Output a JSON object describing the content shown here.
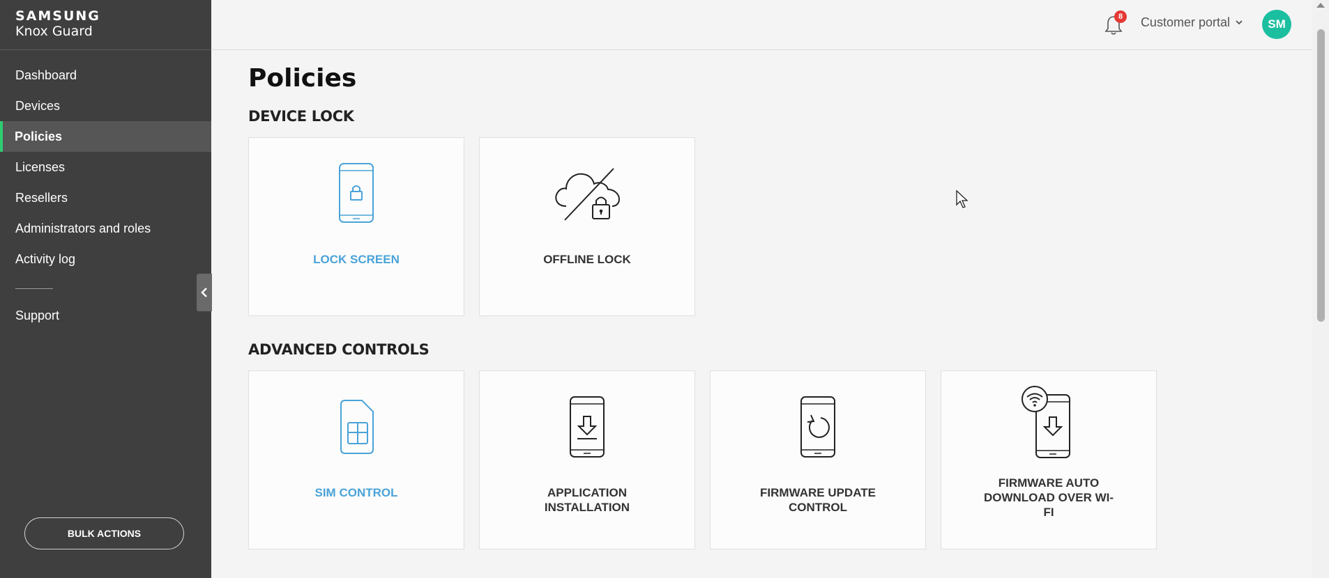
{
  "brand": {
    "line1": "SAMSUNG",
    "line2": "Knox Guard"
  },
  "sidebar": {
    "items": [
      {
        "label": "Dashboard"
      },
      {
        "label": "Devices"
      },
      {
        "label": "Policies"
      },
      {
        "label": "Licenses"
      },
      {
        "label": "Resellers"
      },
      {
        "label": "Administrators and roles"
      },
      {
        "label": "Activity log"
      }
    ],
    "support": "Support",
    "bulk_actions": "BULK ACTIONS"
  },
  "header": {
    "notification_count": "8",
    "portal_label": "Customer portal",
    "avatar_initials": "SM"
  },
  "main": {
    "title": "Policies",
    "device_lock": {
      "heading": "DEVICE LOCK",
      "cards": [
        {
          "label": "LOCK SCREEN",
          "icon": "phone-lock-icon"
        },
        {
          "label": "OFFLINE LOCK",
          "icon": "cloud-offline-lock-icon"
        }
      ]
    },
    "advanced_controls": {
      "heading": "ADVANCED CONTROLS",
      "cards": [
        {
          "label": "SIM CONTROL",
          "icon": "sim-card-icon"
        },
        {
          "label": "APPLICATION INSTALLATION",
          "icon": "phone-download-icon"
        },
        {
          "label": "FIRMWARE UPDATE CONTROL",
          "icon": "phone-refresh-icon"
        },
        {
          "label": "FIRMWARE AUTO DOWNLOAD OVER WI-FI",
          "icon": "phone-wifi-download-icon"
        }
      ]
    }
  },
  "colors": {
    "accent_blue": "#4aa3d8",
    "active_indicator": "#2ecc71",
    "avatar": "#1bbfa0",
    "badge": "#e53935"
  }
}
